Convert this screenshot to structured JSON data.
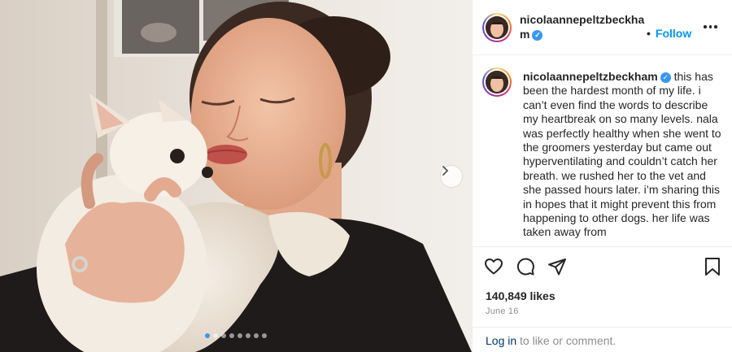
{
  "post": {
    "username": "nicolaannepeltzbeckham",
    "verified": true,
    "follow_label": "Follow",
    "bullet": "•",
    "caption": "this has been the hardest month of my life. i can’t even find the words to describe my heartbreak on so many levels. nala was perfectly healthy when she went to the groomers yesterday but came out hyperventilating and couldn’t catch her breath. we rushed her to the vet and she passed hours later. i’m sharing this in hopes that it might prevent this from happening to other dogs. her life was taken away from",
    "likes": "140,849 likes",
    "date": "June 16",
    "carousel": {
      "total": 8,
      "active": 1
    }
  },
  "footer": {
    "login_label": "Log in",
    "rest_text": "to like or comment."
  },
  "icons": {
    "verified": "verified-badge-icon",
    "next": "chevron-right-icon",
    "more": "more-options-icon",
    "like": "heart-icon",
    "comment": "comment-icon",
    "share": "share-icon",
    "save": "bookmark-icon"
  },
  "colors": {
    "accent": "#0095f6",
    "verified": "#3897f0",
    "text": "#262626",
    "muted": "#8e8e8e",
    "login": "#00376b"
  }
}
